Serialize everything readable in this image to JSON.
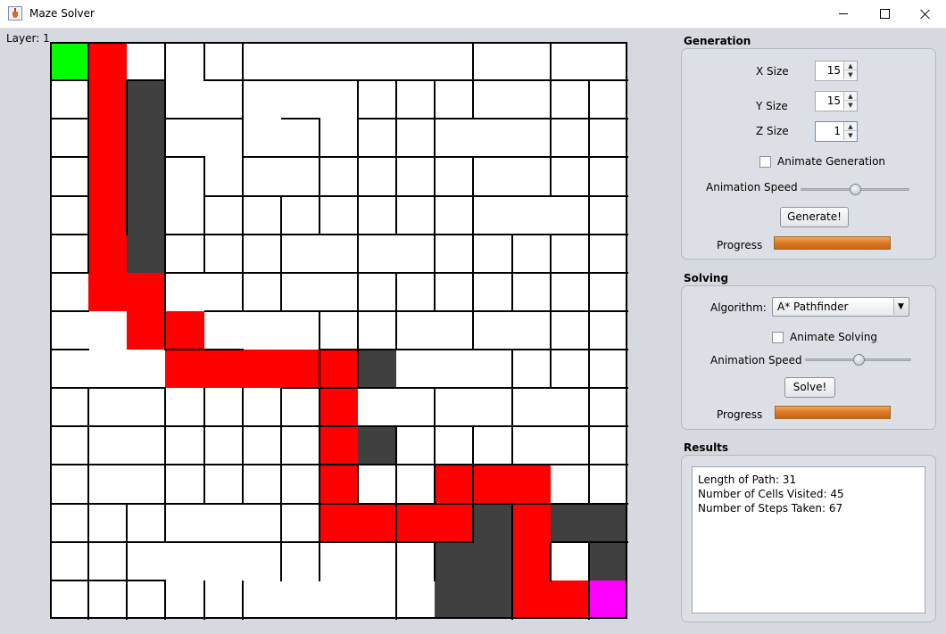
{
  "window": {
    "title": "Maze Solver"
  },
  "maze": {
    "layer_label": "Layer: 1",
    "cols": 15,
    "rows": 15,
    "colors": {
      "start": "#00ff00",
      "end": "#ff00ff",
      "path": "#ff0000",
      "visited": "#404040",
      "empty": "#ffffff",
      "wall": "#000000"
    },
    "start": [
      0,
      0
    ],
    "end": [
      14,
      14
    ],
    "path": [
      [
        1,
        0
      ],
      [
        1,
        1
      ],
      [
        1,
        2
      ],
      [
        1,
        3
      ],
      [
        1,
        4
      ],
      [
        1,
        5
      ],
      [
        1,
        6
      ],
      [
        2,
        6
      ],
      [
        2,
        7
      ],
      [
        3,
        7
      ],
      [
        3,
        8
      ],
      [
        4,
        8
      ],
      [
        5,
        8
      ],
      [
        6,
        8
      ],
      [
        7,
        8
      ],
      [
        7,
        9
      ],
      [
        7,
        10
      ],
      [
        7,
        11
      ],
      [
        7,
        12
      ],
      [
        8,
        12
      ],
      [
        9,
        12
      ],
      [
        10,
        12
      ],
      [
        10,
        11
      ],
      [
        11,
        11
      ],
      [
        12,
        11
      ],
      [
        12,
        12
      ],
      [
        12,
        13
      ],
      [
        12,
        14
      ],
      [
        13,
        14
      ]
    ],
    "visited": [
      [
        2,
        1
      ],
      [
        2,
        2
      ],
      [
        2,
        3
      ],
      [
        2,
        4
      ],
      [
        2,
        5
      ],
      [
        8,
        8
      ],
      [
        8,
        10
      ],
      [
        11,
        12
      ],
      [
        13,
        12
      ],
      [
        14,
        12
      ],
      [
        14,
        13
      ],
      [
        10,
        13
      ],
      [
        11,
        13
      ],
      [
        10,
        14
      ],
      [
        11,
        14
      ]
    ],
    "v_walls": [
      [
        1,
        0
      ],
      [
        1,
        1
      ],
      [
        1,
        2
      ],
      [
        1,
        3
      ],
      [
        1,
        4
      ],
      [
        1,
        5
      ],
      [
        1,
        9
      ],
      [
        1,
        10
      ],
      [
        1,
        11
      ],
      [
        1,
        12
      ],
      [
        1,
        13
      ],
      [
        1,
        14
      ],
      [
        2,
        1
      ],
      [
        2,
        2
      ],
      [
        2,
        3
      ],
      [
        2,
        4
      ],
      [
        2,
        12
      ],
      [
        2,
        13
      ],
      [
        2,
        14
      ],
      [
        3,
        0
      ],
      [
        3,
        1
      ],
      [
        3,
        2
      ],
      [
        3,
        3
      ],
      [
        3,
        4
      ],
      [
        3,
        5
      ],
      [
        3,
        6
      ],
      [
        3,
        7
      ],
      [
        3,
        9
      ],
      [
        3,
        10
      ],
      [
        3,
        11
      ],
      [
        3,
        12
      ],
      [
        3,
        14
      ],
      [
        4,
        0
      ],
      [
        4,
        3
      ],
      [
        4,
        4
      ],
      [
        4,
        5
      ],
      [
        4,
        9
      ],
      [
        4,
        10
      ],
      [
        4,
        11
      ],
      [
        4,
        14
      ],
      [
        5,
        0
      ],
      [
        5,
        1
      ],
      [
        5,
        2
      ],
      [
        5,
        3
      ],
      [
        5,
        4
      ],
      [
        5,
        5
      ],
      [
        5,
        6
      ],
      [
        5,
        9
      ],
      [
        5,
        10
      ],
      [
        5,
        11
      ],
      [
        5,
        14
      ],
      [
        6,
        4
      ],
      [
        6,
        5
      ],
      [
        6,
        6
      ],
      [
        6,
        9
      ],
      [
        6,
        10
      ],
      [
        6,
        11
      ],
      [
        6,
        12
      ],
      [
        6,
        13
      ],
      [
        7,
        2
      ],
      [
        7,
        3
      ],
      [
        7,
        4
      ],
      [
        7,
        7
      ],
      [
        7,
        8
      ],
      [
        7,
        9
      ],
      [
        7,
        10
      ],
      [
        7,
        11
      ],
      [
        7,
        12
      ],
      [
        7,
        13
      ],
      [
        8,
        1
      ],
      [
        8,
        2
      ],
      [
        8,
        3
      ],
      [
        8,
        4
      ],
      [
        8,
        5
      ],
      [
        8,
        6
      ],
      [
        8,
        7
      ],
      [
        8,
        8
      ],
      [
        8,
        11
      ],
      [
        9,
        1
      ],
      [
        9,
        2
      ],
      [
        9,
        3
      ],
      [
        9,
        4
      ],
      [
        9,
        6
      ],
      [
        9,
        7
      ],
      [
        9,
        10
      ],
      [
        9,
        11
      ],
      [
        9,
        12
      ],
      [
        9,
        13
      ],
      [
        9,
        14
      ],
      [
        10,
        1
      ],
      [
        10,
        2
      ],
      [
        10,
        3
      ],
      [
        10,
        4
      ],
      [
        10,
        5
      ],
      [
        10,
        6
      ],
      [
        10,
        9
      ],
      [
        10,
        10
      ],
      [
        10,
        11
      ],
      [
        10,
        13
      ],
      [
        11,
        0
      ],
      [
        11,
        1
      ],
      [
        11,
        3
      ],
      [
        11,
        4
      ],
      [
        11,
        5
      ],
      [
        11,
        6
      ],
      [
        11,
        7
      ],
      [
        11,
        10
      ],
      [
        11,
        11
      ],
      [
        11,
        12
      ],
      [
        12,
        5
      ],
      [
        12,
        6
      ],
      [
        12,
        8
      ],
      [
        12,
        9
      ],
      [
        12,
        10
      ],
      [
        12,
        12
      ],
      [
        12,
        13
      ],
      [
        12,
        14
      ],
      [
        13,
        0
      ],
      [
        13,
        1
      ],
      [
        13,
        2
      ],
      [
        13,
        3
      ],
      [
        13,
        5
      ],
      [
        13,
        6
      ],
      [
        13,
        7
      ],
      [
        13,
        8
      ],
      [
        13,
        13
      ],
      [
        14,
        1
      ],
      [
        14,
        2
      ],
      [
        14,
        3
      ],
      [
        14,
        4
      ],
      [
        14,
        5
      ],
      [
        14,
        6
      ],
      [
        14,
        7
      ],
      [
        14,
        8
      ],
      [
        14,
        9
      ],
      [
        14,
        10
      ],
      [
        14,
        11
      ],
      [
        14,
        13
      ],
      [
        14,
        14
      ]
    ],
    "h_walls": [
      [
        0,
        1
      ],
      [
        0,
        2
      ],
      [
        0,
        3
      ],
      [
        0,
        4
      ],
      [
        0,
        5
      ],
      [
        0,
        6
      ],
      [
        0,
        7
      ],
      [
        0,
        8
      ],
      [
        0,
        9
      ],
      [
        0,
        10
      ],
      [
        0,
        11
      ],
      [
        0,
        12
      ],
      [
        0,
        13
      ],
      [
        0,
        14
      ],
      [
        1,
        9
      ],
      [
        1,
        10
      ],
      [
        1,
        11
      ],
      [
        1,
        12
      ],
      [
        1,
        13
      ],
      [
        1,
        14
      ],
      [
        2,
        1
      ],
      [
        2,
        9
      ],
      [
        2,
        10
      ],
      [
        2,
        11
      ],
      [
        2,
        12
      ],
      [
        2,
        13
      ],
      [
        2,
        14
      ],
      [
        3,
        2
      ],
      [
        3,
        3
      ],
      [
        3,
        5
      ],
      [
        3,
        6
      ],
      [
        3,
        8
      ],
      [
        3,
        10
      ],
      [
        3,
        11
      ],
      [
        3,
        12
      ],
      [
        3,
        13
      ],
      [
        4,
        1
      ],
      [
        4,
        2
      ],
      [
        4,
        4
      ],
      [
        4,
        5
      ],
      [
        4,
        6
      ],
      [
        4,
        7
      ],
      [
        4,
        8
      ],
      [
        4,
        10
      ],
      [
        4,
        11
      ],
      [
        4,
        12
      ],
      [
        4,
        13
      ],
      [
        5,
        1
      ],
      [
        5,
        3
      ],
      [
        5,
        4
      ],
      [
        5,
        5
      ],
      [
        5,
        6
      ],
      [
        5,
        7
      ],
      [
        5,
        10
      ],
      [
        5,
        11
      ],
      [
        5,
        12
      ],
      [
        5,
        13
      ],
      [
        6,
        1
      ],
      [
        6,
        2
      ],
      [
        6,
        3
      ],
      [
        6,
        4
      ],
      [
        6,
        5
      ],
      [
        6,
        6
      ],
      [
        6,
        7
      ],
      [
        6,
        9
      ],
      [
        6,
        10
      ],
      [
        6,
        11
      ],
      [
        6,
        12
      ],
      [
        6,
        13
      ],
      [
        7,
        1
      ],
      [
        7,
        3
      ],
      [
        7,
        4
      ],
      [
        7,
        5
      ],
      [
        7,
        6
      ],
      [
        7,
        7
      ],
      [
        7,
        8
      ],
      [
        7,
        9
      ],
      [
        7,
        10
      ],
      [
        7,
        11
      ],
      [
        7,
        12
      ],
      [
        7,
        13
      ],
      [
        8,
        1
      ],
      [
        8,
        2
      ],
      [
        8,
        3
      ],
      [
        8,
        4
      ],
      [
        8,
        5
      ],
      [
        8,
        6
      ],
      [
        8,
        7
      ],
      [
        8,
        8
      ],
      [
        8,
        9
      ],
      [
        8,
        10
      ],
      [
        8,
        11
      ],
      [
        8,
        12
      ],
      [
        8,
        13
      ],
      [
        9,
        1
      ],
      [
        9,
        2
      ],
      [
        9,
        3
      ],
      [
        9,
        4
      ],
      [
        9,
        5
      ],
      [
        9,
        6
      ],
      [
        9,
        7
      ],
      [
        9,
        8
      ],
      [
        9,
        9
      ],
      [
        9,
        10
      ],
      [
        9,
        11
      ],
      [
        9,
        12
      ],
      [
        9,
        13
      ],
      [
        10,
        1
      ],
      [
        10,
        2
      ],
      [
        10,
        3
      ],
      [
        10,
        4
      ],
      [
        10,
        5
      ],
      [
        10,
        6
      ],
      [
        10,
        7
      ],
      [
        10,
        8
      ],
      [
        10,
        9
      ],
      [
        10,
        10
      ],
      [
        10,
        11
      ],
      [
        10,
        12
      ],
      [
        10,
        13
      ],
      [
        11,
        1
      ],
      [
        11,
        2
      ],
      [
        11,
        3
      ],
      [
        11,
        4
      ],
      [
        11,
        5
      ],
      [
        11,
        6
      ],
      [
        11,
        7
      ],
      [
        11,
        8
      ],
      [
        11,
        9
      ],
      [
        11,
        10
      ],
      [
        11,
        11
      ],
      [
        11,
        12
      ],
      [
        12,
        1
      ],
      [
        12,
        2
      ],
      [
        12,
        3
      ],
      [
        12,
        4
      ],
      [
        12,
        5
      ],
      [
        12,
        6
      ],
      [
        12,
        7
      ],
      [
        12,
        8
      ],
      [
        12,
        9
      ],
      [
        12,
        10
      ],
      [
        12,
        11
      ],
      [
        12,
        12
      ],
      [
        13,
        1
      ],
      [
        13,
        2
      ],
      [
        13,
        3
      ],
      [
        13,
        4
      ],
      [
        13,
        5
      ],
      [
        13,
        6
      ],
      [
        13,
        7
      ],
      [
        13,
        8
      ],
      [
        13,
        9
      ],
      [
        13,
        10
      ],
      [
        13,
        11
      ],
      [
        13,
        12
      ],
      [
        13,
        13
      ],
      [
        14,
        1
      ],
      [
        14,
        2
      ],
      [
        14,
        3
      ],
      [
        14,
        4
      ],
      [
        14,
        5
      ],
      [
        14,
        6
      ],
      [
        14,
        7
      ],
      [
        14,
        8
      ],
      [
        14,
        9
      ],
      [
        14,
        10
      ],
      [
        14,
        11
      ],
      [
        14,
        12
      ],
      [
        14,
        13
      ]
    ]
  },
  "generation": {
    "title": "Generation",
    "x_label": "X Size",
    "x_value": "15",
    "y_label": "Y Size",
    "y_value": "15",
    "z_label": "Z Size",
    "z_value": "1",
    "animate_label": "Animate Generation",
    "animate_checked": false,
    "speed_label": "Animation Speed",
    "speed_value": 0.5,
    "button_label": "Generate!",
    "progress_label": "Progress",
    "progress_value": 1.0
  },
  "solving": {
    "title": "Solving",
    "algorithm_label": "Algorithm:",
    "algorithm_value": "A* Pathfinder",
    "animate_label": "Animate Solving",
    "animate_checked": false,
    "speed_label": "Animation Speed",
    "speed_value": 0.5,
    "button_label": "Solve!",
    "progress_label": "Progress",
    "progress_value": 1.0
  },
  "results": {
    "title": "Results",
    "lines": [
      "Length of Path: 31",
      "Number of Cells Visited: 45",
      "Number of Steps Taken: 67"
    ]
  },
  "icons": {
    "app": "java-cup-icon",
    "minimize": "minimize-icon",
    "maximize": "maximize-icon",
    "close": "close-icon"
  }
}
